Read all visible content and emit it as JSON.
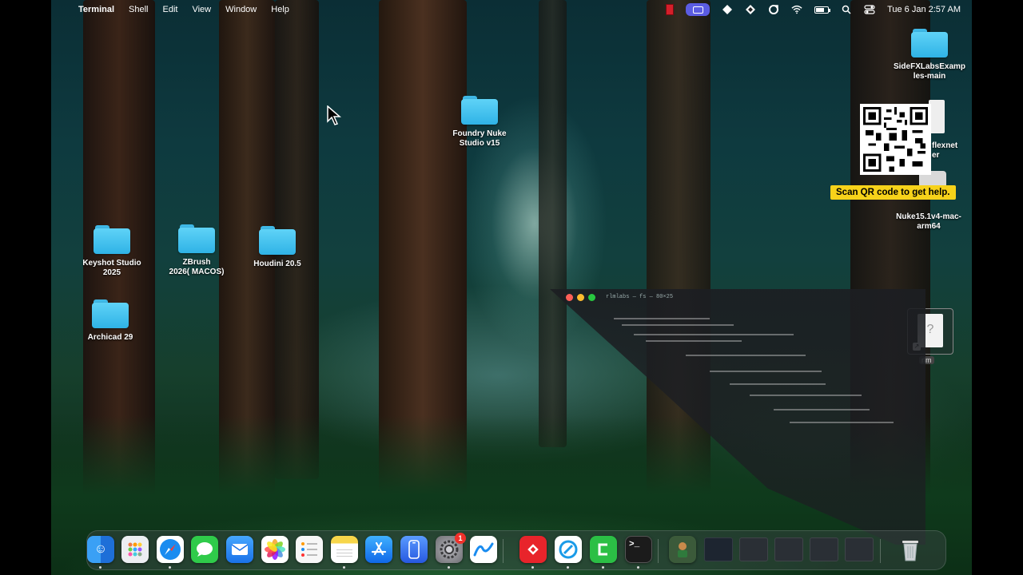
{
  "menubar": {
    "app_name": "Terminal",
    "menus": [
      "Shell",
      "Edit",
      "View",
      "Window",
      "Help"
    ],
    "clock": "Tue 6 Jan  2:57 AM"
  },
  "desktop": {
    "icons": [
      {
        "label": "SideFXLabsExamples-main",
        "label_lines": [
          "SideFXLabsExamp",
          "les-main"
        ]
      },
      {
        "label": "Foundry Nuke Studio v15",
        "label_lines": [
          "Foundry Nuke",
          "Studio v15"
        ]
      },
      {
        "label": "Keyshot Studio 2025",
        "label_lines": [
          "Keyshot Studio",
          "2025"
        ]
      },
      {
        "label": "ZBrush 2026( MACOS)",
        "label_lines": [
          "ZBrush",
          "2026( MACOS)"
        ]
      },
      {
        "label": "Houdini 20.5",
        "label_lines": [
          "Houdini 20.5"
        ]
      },
      {
        "label": "Archicad 29",
        "label_lines": [
          "Archicad 29"
        ]
      }
    ],
    "partial_labels": [
      "flexnet",
      "er"
    ],
    "nuke_item": {
      "label_lines": [
        "Nuke15.1v4-mac-",
        "arm64"
      ]
    },
    "rlm_label": "rlm",
    "qr_caption": "Scan QR code to get help."
  },
  "terminal_window": {
    "title": "rlmlabs — fs — 80×25"
  },
  "dock": {
    "apps": [
      {
        "name": "Finder",
        "icon": "finder-icon",
        "color": "#1e7fe6"
      },
      {
        "name": "Launchpad",
        "icon": "launchpad-icon",
        "color": "#e8e8ec"
      },
      {
        "name": "Safari",
        "icon": "safari-icon",
        "color": "#1a8cf0"
      },
      {
        "name": "Messages",
        "icon": "messages-icon",
        "color": "#2fcb4a"
      },
      {
        "name": "Mail",
        "icon": "mail-icon",
        "color": "#2a86f2"
      },
      {
        "name": "Photos",
        "icon": "photos-icon",
        "color": "#ffffff"
      },
      {
        "name": "Reminders",
        "icon": "reminders-icon",
        "color": "#f5f5f5"
      },
      {
        "name": "Notes",
        "icon": "notes-icon",
        "color": "#f7d64a"
      },
      {
        "name": "App Store",
        "icon": "appstore-icon",
        "color": "#1d8bf5"
      },
      {
        "name": "iPhone Mirroring",
        "icon": "iphone-mirroring-icon",
        "color": "#2b6ef0"
      },
      {
        "name": "System Settings",
        "icon": "settings-icon",
        "color": "#8a8a8f",
        "badge": "1"
      },
      {
        "name": "Freeform",
        "icon": "freeform-icon",
        "color": "#ffffff"
      },
      {
        "name": "AnyDesk",
        "icon": "anydesk-icon",
        "color": "#e8242b"
      },
      {
        "name": "Navigator",
        "icon": "navigator-icon",
        "color": "#ffffff"
      },
      {
        "name": "Camtasia",
        "icon": "camtasia-icon",
        "color": "#2bbf45"
      },
      {
        "name": "Terminal",
        "icon": "terminal-icon",
        "color": "#1b1b1b"
      }
    ]
  }
}
